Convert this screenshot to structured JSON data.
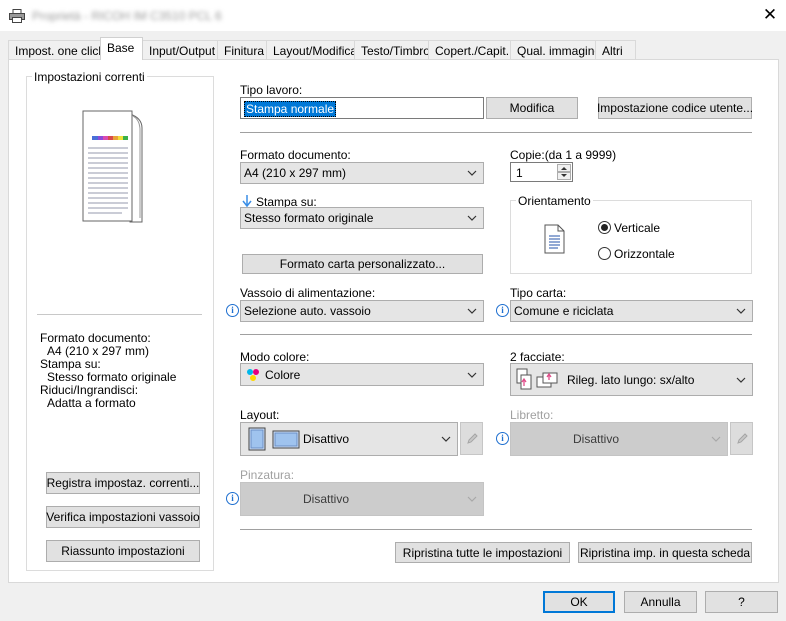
{
  "window": {
    "title": "Proprietà - RICOH IM C3510 PCL 6",
    "close_label": "✕"
  },
  "tabs": [
    {
      "label": "Impost. one click"
    },
    {
      "label": "Base"
    },
    {
      "label": "Input/Output"
    },
    {
      "label": "Finitura"
    },
    {
      "label": "Layout/Modifica"
    },
    {
      "label": "Testo/Timbro"
    },
    {
      "label": "Copert./Capit."
    },
    {
      "label": "Qual. immagine"
    },
    {
      "label": "Altri"
    }
  ],
  "current_settings": {
    "title": "Impostazioni correnti",
    "summary": [
      "Formato documento:",
      "A4 (210 x 297 mm)",
      "Stampa su:",
      "Stesso formato originale",
      "Riduci/Ingrandisci:",
      "Adatta a formato"
    ],
    "buttons": [
      "Registra impostaz. correnti...",
      "Verifica impostazioni vassoio",
      "Riassunto impostazioni"
    ]
  },
  "job": {
    "label": "Tipo lavoro:",
    "value": "Stampa normale",
    "modify_label": "Modifica",
    "user_code_label": "Impostazione codice utente..."
  },
  "document_size": {
    "label": "Formato documento:",
    "value": "A4 (210 x 297 mm)"
  },
  "copies": {
    "label": "Copie:(da 1 a 9999)",
    "value": "1"
  },
  "print_on": {
    "label": "Stampa su:",
    "value": "Stesso formato originale"
  },
  "orientation": {
    "title": "Orientamento",
    "portrait": "Verticale",
    "landscape": "Orizzontale",
    "selected": "Verticale"
  },
  "custom_paper_label": "Formato carta personalizzato...",
  "input_tray": {
    "label": "Vassoio di alimentazione:",
    "value": "Selezione auto. vassoio"
  },
  "paper_type": {
    "label": "Tipo carta:",
    "value": "Comune e riciclata"
  },
  "color_mode": {
    "label": "Modo colore:",
    "value": "Colore"
  },
  "duplex": {
    "label": "2 facciate:",
    "value": "Rileg. lato lungo: sx/alto"
  },
  "layout": {
    "label": "Layout:",
    "value": "Disattivo"
  },
  "booklet": {
    "label": "Libretto:",
    "value": "Disattivo"
  },
  "staple": {
    "label": "Pinzatura:",
    "value": "Disattivo"
  },
  "reset_all_label": "Ripristina tutte le impostazioni",
  "reset_tab_label": "Ripristina imp. in questa scheda",
  "footer": {
    "ok": "OK",
    "cancel": "Annulla",
    "help": "?"
  },
  "colors": {
    "accent": "#0078d7",
    "info": "#1e6fd0"
  }
}
